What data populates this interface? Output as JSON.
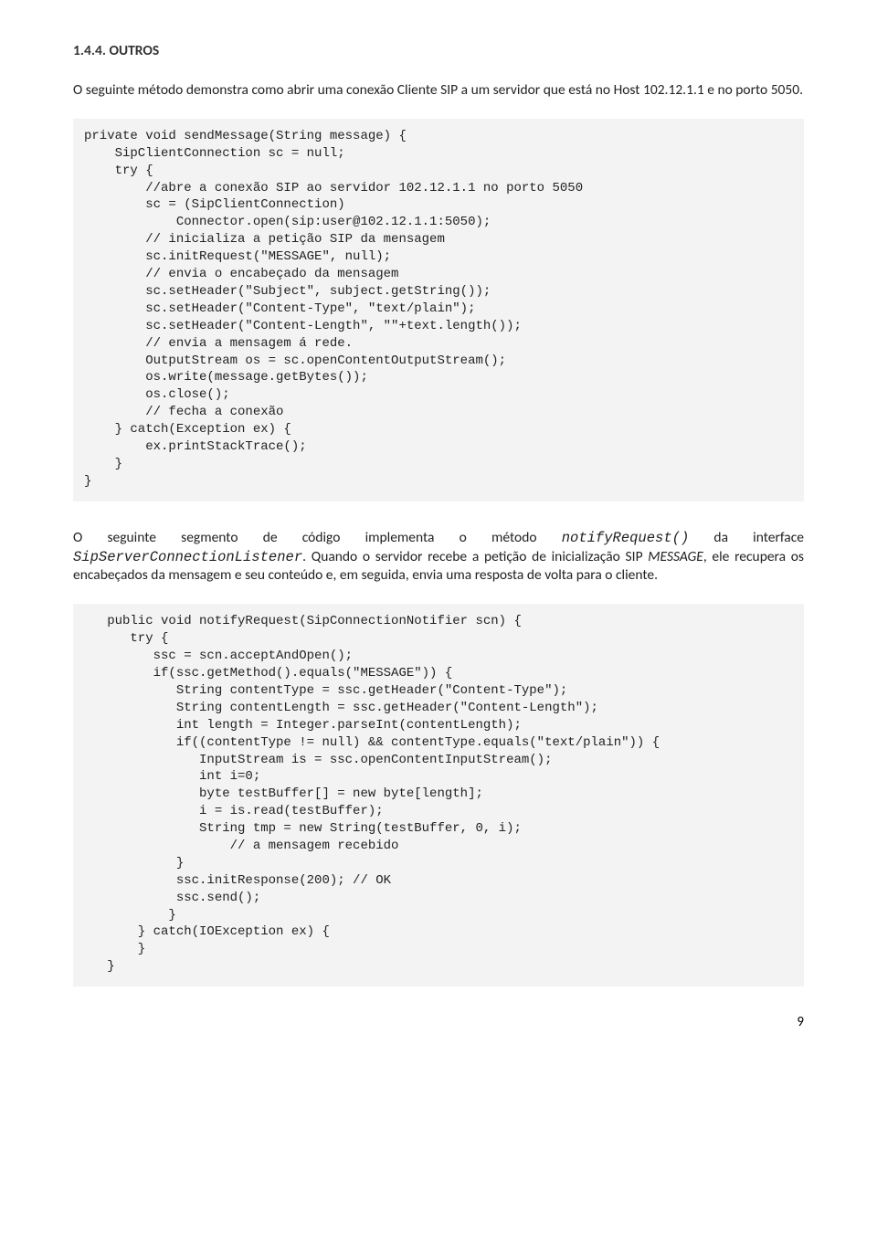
{
  "heading": "1.4.4.  OUTROS",
  "para1": "O seguinte método demonstra como abrir uma conexão Cliente SIP a um servidor que está no Host 102.12.1.1 e no porto 5050.",
  "code1": "private void sendMessage(String message) {\n    SipClientConnection sc = null;\n    try {\n        //abre a conexão SIP ao servidor 102.12.1.1 no porto 5050\n        sc = (SipClientConnection)\n            Connector.open(sip:user@102.12.1.1:5050);\n        // inicializa a petição SIP da mensagem\n        sc.initRequest(\"MESSAGE\", null);\n        // envia o encabeçado da mensagem\n        sc.setHeader(\"Subject\", subject.getString());\n        sc.setHeader(\"Content-Type\", \"text/plain\");\n        sc.setHeader(\"Content-Length\", \"\"+text.length());\n        // envia a mensagem á rede.\n        OutputStream os = sc.openContentOutputStream();\n        os.write(message.getBytes());\n        os.close();\n        // fecha a conexão\n    } catch(Exception ex) {\n        ex.printStackTrace();\n    }\n}",
  "para2_a": "O seguinte segmento de código implementa o método ",
  "para2_notify": "notifyRequest()",
  "para2_b": " da interface ",
  "para2_listener": "SipServerConnectionListener",
  "para2_c": ". Quando o servidor recebe a petição de inicialização SIP ",
  "para2_message": "MESSAGE",
  "para2_d": ", ele recupera os encabeçados da mensagem e seu conteúdo e, em seguida, envia uma resposta de volta para o cliente.",
  "code2": "   public void notifyRequest(SipConnectionNotifier scn) {\n      try {\n         ssc = scn.acceptAndOpen();\n         if(ssc.getMethod().equals(\"MESSAGE\")) {\n            String contentType = ssc.getHeader(\"Content-Type\");\n            String contentLength = ssc.getHeader(\"Content-Length\");\n            int length = Integer.parseInt(contentLength);\n            if((contentType != null) && contentType.equals(\"text/plain\")) {\n               InputStream is = ssc.openContentInputStream();\n               int i=0;\n               byte testBuffer[] = new byte[length];\n               i = is.read(testBuffer);\n               String tmp = new String(testBuffer, 0, i);\n                   // a mensagem recebido\n            }\n            ssc.initResponse(200); // OK\n            ssc.send();\n           }\n       } catch(IOException ex) {\n       }\n   }",
  "pagenum": "9"
}
